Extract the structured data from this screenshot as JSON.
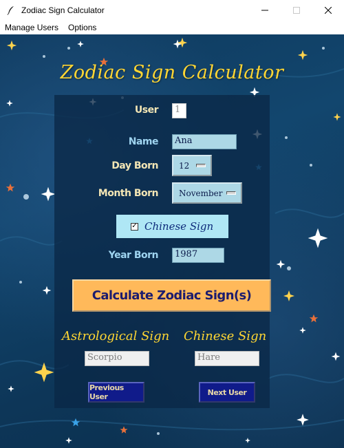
{
  "window": {
    "title": "Zodiac Sign Calculator",
    "minimize_symbol": "—",
    "maximize_symbol": "☐",
    "close_symbol": "✕"
  },
  "menu": {
    "items": [
      "Manage Users",
      "Options"
    ]
  },
  "app": {
    "heading": "Zodiac Sign Calculator",
    "user_label": "User",
    "user_value": "1",
    "name_label": "Name",
    "name_value": "Ana",
    "day_label": "Day Born",
    "day_value": "12",
    "month_label": "Month Born",
    "month_value": "November",
    "chinese_checkbox_label": "Chinese Sign",
    "chinese_checkbox_checked": true,
    "checkmark": "✓",
    "year_label": "Year Born",
    "year_value": "1987",
    "calculate_label": "Calculate Zodiac Sign(s)",
    "astro_heading": "Astrological Sign",
    "chinese_heading": "Chinese Sign",
    "astro_value": "Scorpio",
    "chinese_value": "Hare",
    "prev_label": "Previous User",
    "next_label": "Next User"
  },
  "colors": {
    "heading": "#ffd633",
    "field_bg": "#add8e6",
    "calc_button": "#ffb95a",
    "nav_button": "#101b8a"
  }
}
